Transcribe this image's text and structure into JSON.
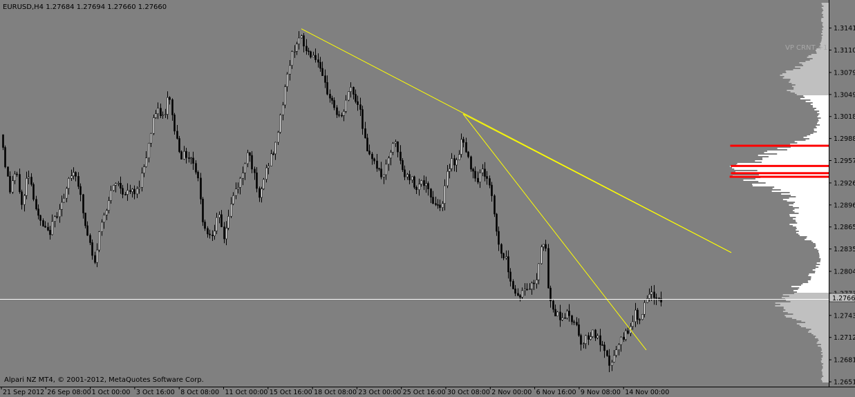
{
  "window": {
    "symbol_header": "EURUSD,H4  1.27684 1.27694 1.27660 1.27660",
    "copyright": "Alpari NZ MT4, © 2001-2012, MetaQuotes Software Corp.",
    "indicator_label": "VP CRNT +1"
  },
  "colors": {
    "background": "#808080",
    "candle": "#000000",
    "trendline": "#ffff00",
    "bidline": "#ffffff",
    "profile_hist": "#ffffff",
    "profile_hist_dim": "#c0c0c0",
    "profile_peak": "#ff0000",
    "axis": "#000000"
  },
  "chart_data": {
    "type": "candlestick",
    "symbol": "EURUSD",
    "timeframe": "H4",
    "current_price": 1.2766,
    "current_price_label": "1.27660",
    "ylim": [
      1.2651,
      1.3155
    ],
    "y_ticks": [
      "1.31410",
      "1.31105",
      "1.30795",
      "1.30490",
      "1.30185",
      "1.29880",
      "1.29575",
      "1.29265",
      "1.28960",
      "1.28655",
      "1.28350",
      "1.28040",
      "1.27735",
      "1.27430",
      "1.27125",
      "1.26815",
      "1.26510"
    ],
    "x_ticks": [
      "21 Sep 2012",
      "26 Sep 08:00",
      "1 Oct 00:00",
      "3 Oct 16:00",
      "8 Oct 08:00",
      "11 Oct 00:00",
      "15 Oct 16:00",
      "18 Oct 08:00",
      "23 Oct 00:00",
      "25 Oct 16:00",
      "30 Oct 08:00",
      "2 Nov 00:00",
      "6 Nov 16:00",
      "9 Nov 08:00",
      "14 Nov 00:00"
    ],
    "close_path": [
      [
        0,
        1.301
      ],
      [
        6,
        1.296
      ],
      [
        14,
        1.2915
      ],
      [
        20,
        1.294
      ],
      [
        26,
        1.293
      ],
      [
        32,
        1.289
      ],
      [
        40,
        1.2945
      ],
      [
        46,
        1.292
      ],
      [
        54,
        1.288
      ],
      [
        62,
        1.2865
      ],
      [
        70,
        1.2855
      ],
      [
        78,
        1.2875
      ],
      [
        86,
        1.2895
      ],
      [
        94,
        1.2905
      ],
      [
        100,
        1.2935
      ],
      [
        108,
        1.2945
      ],
      [
        114,
        1.292
      ],
      [
        122,
        1.287
      ],
      [
        130,
        1.284
      ],
      [
        136,
        1.281
      ],
      [
        142,
        1.285
      ],
      [
        150,
        1.2885
      ],
      [
        158,
        1.2905
      ],
      [
        166,
        1.2925
      ],
      [
        172,
        1.2925
      ],
      [
        180,
        1.291
      ],
      [
        188,
        1.2915
      ],
      [
        196,
        1.291
      ],
      [
        204,
        1.2935
      ],
      [
        210,
        1.296
      ],
      [
        216,
        1.2985
      ],
      [
        222,
        1.302
      ],
      [
        230,
        1.3025
      ],
      [
        238,
        1.3015
      ],
      [
        244,
        1.3055
      ],
      [
        250,
        1.301
      ],
      [
        256,
        1.2985
      ],
      [
        262,
        1.2965
      ],
      [
        270,
        1.2965
      ],
      [
        278,
        1.296
      ],
      [
        286,
        1.2935
      ],
      [
        292,
        1.288
      ],
      [
        300,
        1.2855
      ],
      [
        308,
        1.286
      ],
      [
        316,
        1.288
      ],
      [
        324,
        1.285
      ],
      [
        330,
        1.288
      ],
      [
        336,
        1.2905
      ],
      [
        342,
        1.292
      ],
      [
        350,
        1.2935
      ],
      [
        358,
        1.2975
      ],
      [
        366,
        1.2945
      ],
      [
        374,
        1.29
      ],
      [
        382,
        1.2935
      ],
      [
        390,
        1.296
      ],
      [
        398,
        1.2975
      ],
      [
        404,
        1.3015
      ],
      [
        410,
        1.3045
      ],
      [
        418,
        1.309
      ],
      [
        424,
        1.311
      ],
      [
        430,
        1.3125
      ],
      [
        436,
        1.3125
      ],
      [
        442,
        1.311
      ],
      [
        450,
        1.3105
      ],
      [
        458,
        1.31
      ],
      [
        464,
        1.3075
      ],
      [
        472,
        1.3055
      ],
      [
        480,
        1.304
      ],
      [
        488,
        1.302
      ],
      [
        494,
        1.3015
      ],
      [
        500,
        1.304
      ],
      [
        508,
        1.306
      ],
      [
        514,
        1.304
      ],
      [
        520,
        1.3035
      ],
      [
        526,
        1.2995
      ],
      [
        532,
        1.296
      ],
      [
        540,
        1.2965
      ],
      [
        546,
        1.2945
      ],
      [
        552,
        1.2935
      ],
      [
        560,
        1.295
      ],
      [
        566,
        1.2975
      ],
      [
        572,
        1.298
      ],
      [
        580,
        1.295
      ],
      [
        586,
        1.2935
      ],
      [
        594,
        1.2935
      ],
      [
        600,
        1.292
      ],
      [
        608,
        1.293
      ],
      [
        616,
        1.292
      ],
      [
        624,
        1.2905
      ],
      [
        632,
        1.2895
      ],
      [
        640,
        1.29
      ],
      [
        646,
        1.2935
      ],
      [
        652,
        1.296
      ],
      [
        660,
        1.2955
      ],
      [
        668,
        1.299
      ],
      [
        676,
        1.296
      ],
      [
        684,
        1.2945
      ],
      [
        690,
        1.293
      ],
      [
        696,
        1.2945
      ],
      [
        704,
        1.2935
      ],
      [
        712,
        1.2905
      ],
      [
        718,
        1.286
      ],
      [
        724,
        1.283
      ],
      [
        730,
        1.2825
      ],
      [
        736,
        1.2805
      ],
      [
        742,
        1.278
      ],
      [
        748,
        1.277
      ],
      [
        756,
        1.2775
      ],
      [
        762,
        1.278
      ],
      [
        770,
        1.2785
      ],
      [
        776,
        1.2795
      ],
      [
        782,
        1.284
      ],
      [
        788,
        1.285
      ],
      [
        794,
        1.2765
      ],
      [
        800,
        1.275
      ],
      [
        806,
        1.2745
      ],
      [
        812,
        1.274
      ],
      [
        820,
        1.2745
      ],
      [
        826,
        1.2735
      ],
      [
        832,
        1.274
      ],
      [
        838,
        1.271
      ],
      [
        844,
        1.2705
      ],
      [
        850,
        1.2715
      ],
      [
        858,
        1.272
      ],
      [
        864,
        1.271
      ],
      [
        870,
        1.27
      ],
      [
        876,
        1.2685
      ],
      [
        882,
        1.2675
      ],
      [
        888,
        1.2685
      ],
      [
        894,
        1.27
      ],
      [
        900,
        1.271
      ],
      [
        906,
        1.272
      ],
      [
        912,
        1.273
      ],
      [
        918,
        1.2745
      ],
      [
        924,
        1.274
      ],
      [
        930,
        1.275
      ],
      [
        936,
        1.2765
      ],
      [
        942,
        1.277
      ],
      [
        948,
        1.277
      ],
      [
        954,
        1.2766
      ]
    ],
    "trendlines": [
      {
        "from": [
          436,
          1.314
        ],
        "to": [
          1058,
          1.283
        ]
      },
      {
        "from": [
          670,
          1.3022
        ],
        "to": [
          1058,
          1.283
        ]
      },
      {
        "from": [
          670,
          1.3022
        ],
        "to": [
          935,
          1.2695
        ]
      }
    ],
    "volume_profile": {
      "peaks": [
        1.2978,
        1.295,
        1.294,
        1.2935
      ],
      "highlight_band": [
        1.2776,
        1.3048
      ]
    }
  }
}
